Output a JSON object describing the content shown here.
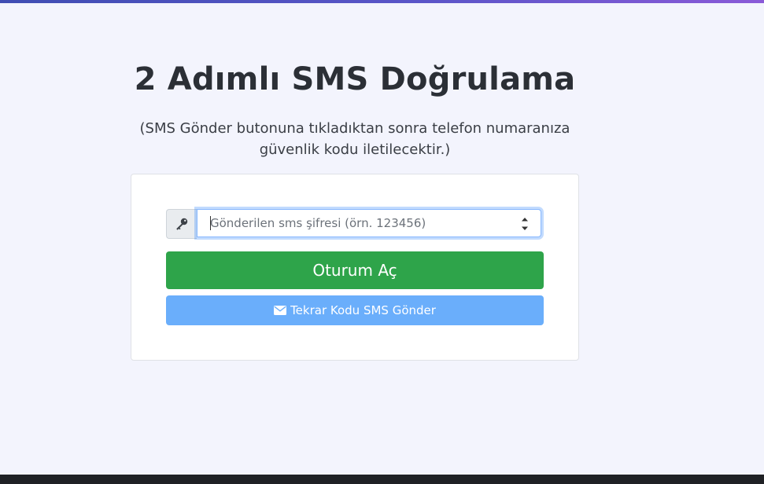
{
  "page": {
    "title": "2 Adımlı SMS Doğrulama",
    "subtitle": "(SMS Gönder butonuna tıkladıktan sonra telefon numaranıza güvenlik kodu iletilecektir.)"
  },
  "form": {
    "code_input": {
      "placeholder": "Gönderilen sms şifresi (örn. 123456)",
      "value": "",
      "addon_icon": "key-icon"
    },
    "login_button": {
      "label": "Oturum Aç"
    },
    "resend_button": {
      "label": "Tekrar Kodu SMS Gönder",
      "icon": "envelope-icon"
    }
  },
  "colors": {
    "login_button": "#2ea44a",
    "resend_button": "#6aaefb",
    "page_background": "#f3f4fd",
    "top_bar_gradient_start": "#3f4db3",
    "top_bar_gradient_end": "#8a5ad8"
  }
}
